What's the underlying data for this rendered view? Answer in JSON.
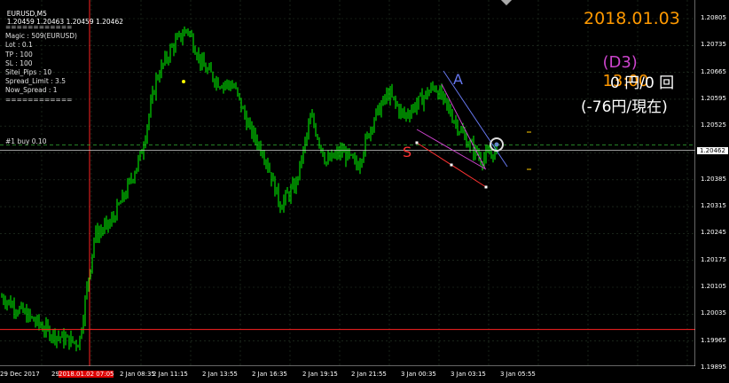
{
  "header": {
    "symbol": "EURUSD,M5",
    "ohlc": "1.20459 1.20463 1.20459 1.20462"
  },
  "info_panel": [
    "============",
    "Magic : 509(EURUSD)",
    "Lot : 0.1",
    "TP : 100",
    "SL : 100",
    "Sitei_Pips : 10",
    "Spread_Limit : 3.5",
    "Now_Spread : 1",
    "============"
  ],
  "order_label": "#1 buy 0.10",
  "overlay": {
    "date": "2018.01.03",
    "day_tag": "(D3)",
    "time": "13:00",
    "profit": "0 円/0 回",
    "current": "(-76円/現在)"
  },
  "labels": {
    "a": "A",
    "s": "S"
  },
  "colors": {
    "background": "#000000",
    "candles": "#00ff00",
    "grid": "#2a3a2a",
    "date_text": "#ff9900",
    "day_tag": "#cc44cc",
    "red_line": "#ff2222",
    "bid_line": "#cccccc",
    "ask_line": "#33aa33",
    "label_a": "#6677ee",
    "label_s": "#ff3333"
  },
  "price_axis": {
    "ticks": [
      "1.20805",
      "1.20735",
      "1.20665",
      "1.20595",
      "1.20525",
      "1.20462",
      "1.20385",
      "1.20315",
      "1.20245",
      "1.20175",
      "1.20105",
      "1.20035",
      "1.19965",
      "1.19895"
    ]
  },
  "time_axis": {
    "ticks": [
      "29 Dec 2017",
      "29",
      "2 Jan 08:35",
      "2 Jan 11:15",
      "2 Jan 13:55",
      "2 Jan 16:35",
      "2 Jan 19:15",
      "2 Jan 21:55",
      "3 Jan 00:35",
      "3 Jan 03:15",
      "3 Jan 05:55"
    ],
    "highlight": "2018.01.02 07:05"
  },
  "chart_data": {
    "type": "candlestick",
    "symbol": "EURUSD",
    "timeframe": "M5",
    "bid": 1.20462,
    "ylim": [
      1.19895,
      1.20805
    ],
    "horizontal_line": 1.19995,
    "approx_closes": [
      1.2008,
      1.2005,
      1.2002,
      1.1999,
      1.1997,
      1.1996,
      1.2024,
      1.2027,
      1.2035,
      1.2045,
      1.2065,
      1.2073,
      1.2078,
      1.2068,
      1.2064,
      1.2063,
      1.2052,
      1.2045,
      1.2032,
      1.2037,
      1.2055,
      1.2043,
      1.2046,
      1.2042,
      1.2054,
      1.2061,
      1.2055,
      1.2059,
      1.2063,
      1.2056,
      1.2049,
      1.2044,
      1.2046
    ]
  }
}
